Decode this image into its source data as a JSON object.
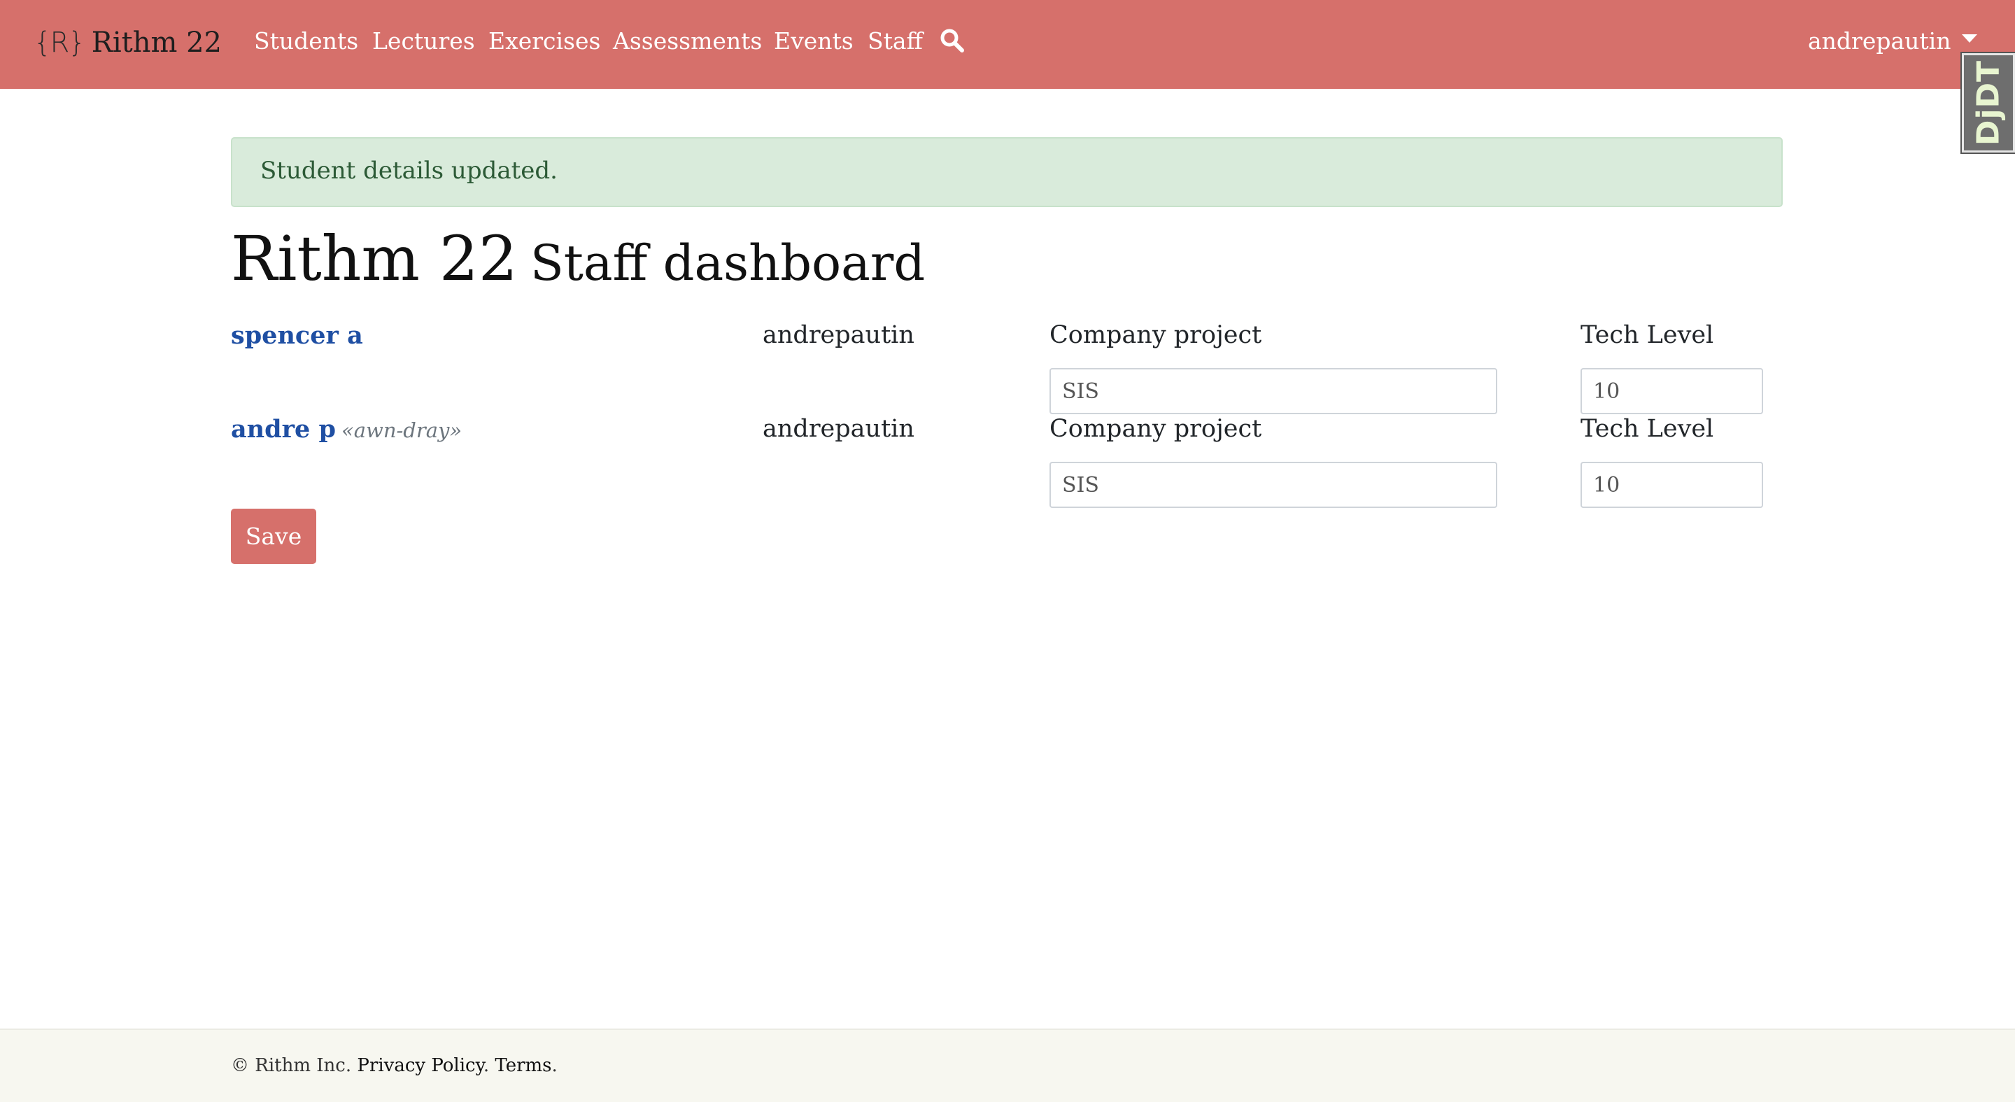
{
  "navbar": {
    "brand_logo": "{R}",
    "brand_text": "Rithm 22",
    "items": [
      "Students",
      "Lectures",
      "Exercises",
      "Assessments",
      "Events",
      "Staff"
    ],
    "search_icon": "search-icon",
    "user": "andrepautin"
  },
  "debug_toolbar": {
    "label": "DjDT"
  },
  "alert": {
    "message": "Student details updated."
  },
  "page": {
    "title_main": "Rithm 22",
    "title_sub": "Staff dashboard"
  },
  "students": [
    {
      "name": "spencer a",
      "nickname": "",
      "owner": "andrepautin",
      "company_project_label": "Company project",
      "company_project_value": "SIS",
      "tech_level_label": "Tech Level",
      "tech_level_value": "10"
    },
    {
      "name": "andre p",
      "nickname": "«awn-dray»",
      "owner": "andrepautin",
      "company_project_label": "Company project",
      "company_project_value": "SIS",
      "tech_level_label": "Tech Level",
      "tech_level_value": "10"
    }
  ],
  "form": {
    "save_label": "Save"
  },
  "footer": {
    "copyright": "© Rithm Inc.",
    "privacy": "Privacy Policy",
    "terms": "Terms"
  },
  "colors": {
    "navbar": "#d6706b",
    "alert_bg": "#d9ebdb",
    "link": "#1f4fa3",
    "footer_bg": "#f7f7f0"
  }
}
